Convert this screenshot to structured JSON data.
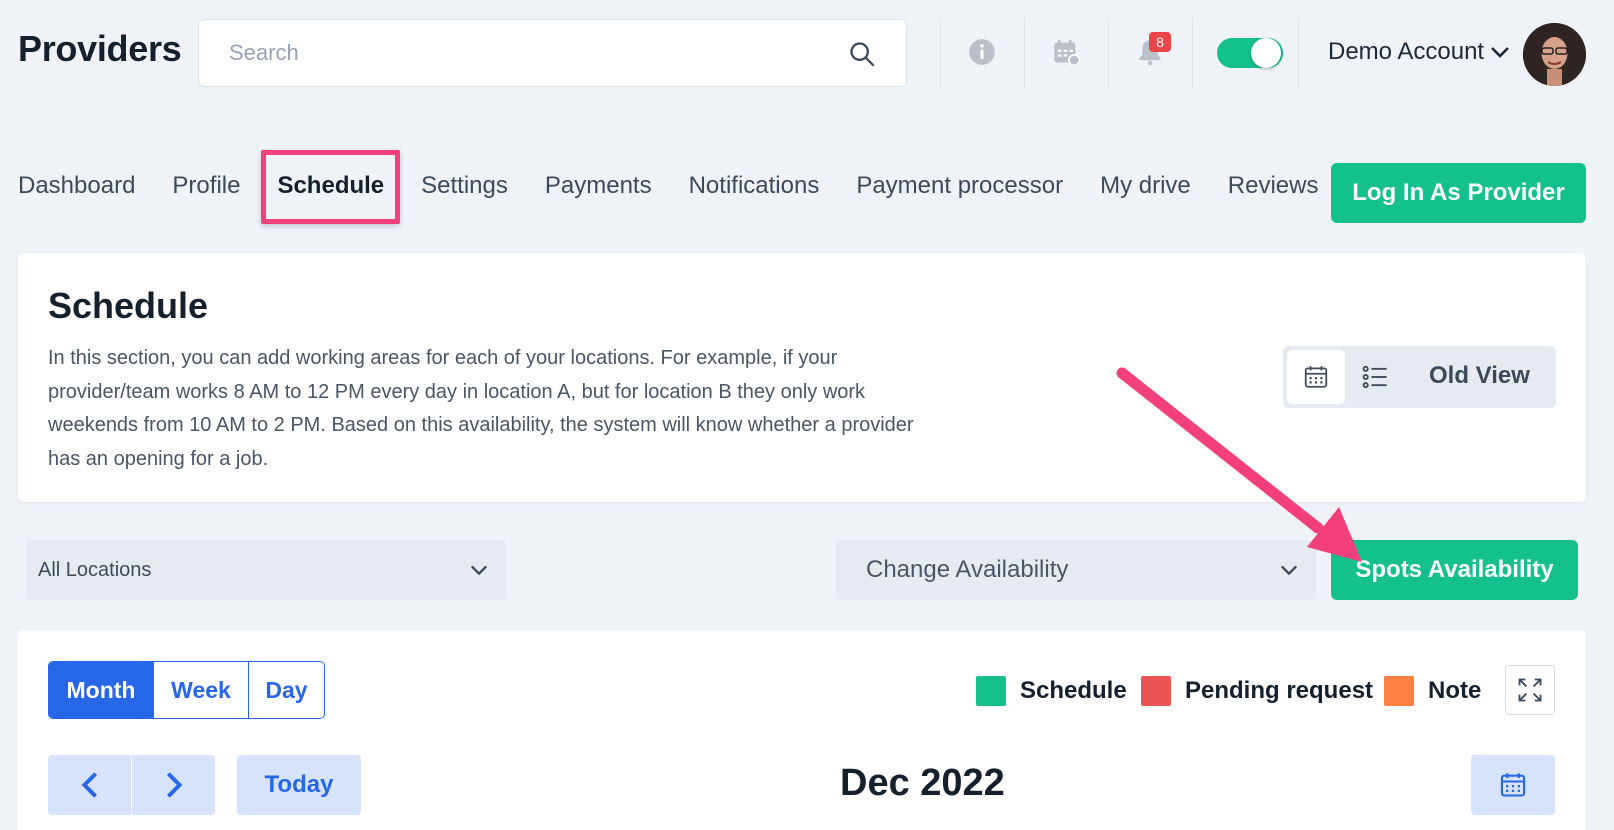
{
  "header": {
    "title": "Providers",
    "search_placeholder": "Search",
    "notification_count": "8",
    "account_label": "Demo Account",
    "toggle_on": true
  },
  "nav": {
    "tabs": [
      "Dashboard",
      "Profile",
      "Schedule",
      "Settings",
      "Payments",
      "Notifications",
      "Payment processor",
      "My drive",
      "Reviews"
    ],
    "active": "Schedule",
    "login_button": "Log In As Provider"
  },
  "schedule_card": {
    "title": "Schedule",
    "description": "In this section, you can add working areas for each of your locations. For example, if your provider/team works 8 AM to 12 PM every day in location A, but for location B they only work weekends from 10 AM to 2 PM. Based on this availability, the system will know whether a provider has an opening for a job.",
    "old_view_label": "Old View"
  },
  "filters": {
    "location_value": "All Locations",
    "availability_value": "Change Availability",
    "spots_button": "Spots Availability"
  },
  "calendar": {
    "views": [
      "Month",
      "Week",
      "Day"
    ],
    "active_view": "Month",
    "legend": [
      {
        "label": "Schedule",
        "color": "#14c18d"
      },
      {
        "label": "Pending request",
        "color": "#ea5455"
      },
      {
        "label": "Note",
        "color": "#ff7f45"
      }
    ],
    "today_label": "Today",
    "month_title": "Dec 2022"
  },
  "colors": {
    "accent_green": "#14c18d",
    "accent_blue": "#2866e8",
    "highlight_pink": "#f43f7d"
  }
}
